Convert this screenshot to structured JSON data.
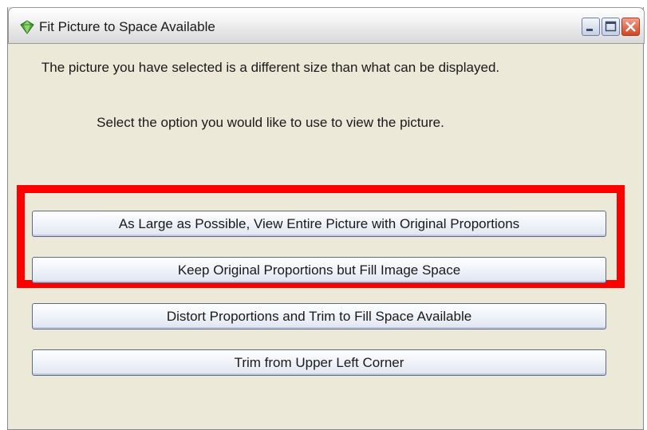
{
  "window": {
    "title": "Fit Picture to Space Available"
  },
  "message": {
    "line1": "The picture you have selected is a different size than what can be displayed.",
    "line2": "Select the option you would like to use to view the picture."
  },
  "options": [
    {
      "label": "As Large as Possible, View Entire Picture with Original Proportions"
    },
    {
      "label": "Keep Original Proportions but Fill Image Space"
    },
    {
      "label": "Distort Proportions and Trim to Fill Space Available"
    },
    {
      "label": "Trim from Upper Left Corner"
    }
  ],
  "colors": {
    "highlight": "#ff0000",
    "window_bg": "#ece9d8",
    "close_button": "#d2461f"
  },
  "icons": {
    "app": "gem-icon",
    "minimize": "minimize-icon",
    "maximize": "maximize-icon",
    "close": "close-icon"
  }
}
